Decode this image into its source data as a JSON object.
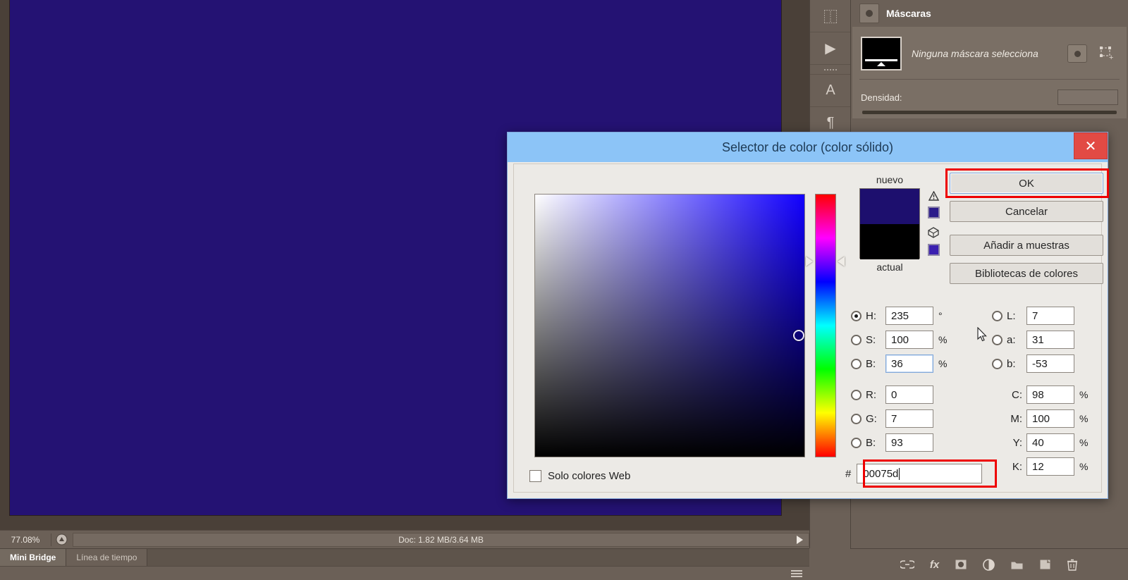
{
  "app": {
    "canvas_color": "#241273",
    "workspace_bg": "#6b6057"
  },
  "statusbar": {
    "zoom": "77.08%",
    "doc_info": "Doc: 1.82 MB/3.64 MB",
    "thumb_icon": "document-thumbnail-icon",
    "play_icon": "play-arrow-icon"
  },
  "taskbar": {
    "tabs": [
      {
        "label": "Mini Bridge",
        "active": true
      },
      {
        "label": "Línea de tiempo",
        "active": false
      }
    ],
    "menu_icon": "hamburger-menu-icon"
  },
  "tool_strip": {
    "items": [
      {
        "icon": "align-icon",
        "glyph": "⿰"
      },
      {
        "icon": "play-triangle-icon",
        "glyph": "▶"
      },
      {
        "icon": "grip-icon",
        "glyph": ""
      },
      {
        "icon": "character-panel-icon",
        "glyph": "A"
      },
      {
        "icon": "paragraph-panel-icon",
        "glyph": "¶"
      }
    ]
  },
  "masks_panel": {
    "title": "Máscaras",
    "header_icon": "mask-panel-icon",
    "mask_status": "Ninguna máscara selecciona",
    "pixel_mask_icon": "pixel-mask-icon",
    "vector_mask_icon": "vector-mask-add-icon",
    "density": {
      "label": "Densidad:",
      "value": ""
    }
  },
  "layer_bottom_bar": {
    "icons": [
      {
        "name": "link-layers-icon",
        "glyph": "🔗"
      },
      {
        "name": "layer-style-fx-icon",
        "glyph": "fx"
      },
      {
        "name": "add-layer-mask-icon",
        "glyph": "▣"
      },
      {
        "name": "adjustment-layer-icon",
        "glyph": "◐"
      },
      {
        "name": "new-group-icon",
        "glyph": "🗀"
      },
      {
        "name": "new-layer-icon",
        "glyph": "❐"
      },
      {
        "name": "delete-layer-icon",
        "glyph": "🗑"
      }
    ]
  },
  "dialog": {
    "title": "Selector de color (color sólido)",
    "close_icon": "close-icon",
    "preview": {
      "new_label": "nuevo",
      "current_label": "actual",
      "new_color": "#1d0f6e",
      "current_color": "#000000"
    },
    "warnings": {
      "gamut_icon": "out-of-gamut-warning-icon",
      "gamut_swatch": "#2b1b8a",
      "websafe_icon": "non-websafe-cube-icon",
      "websafe_swatch": "#3a1fb0"
    },
    "buttons": {
      "ok": "OK",
      "cancel": "Cancelar",
      "add_swatch": "Añadir a muestras",
      "color_libraries": "Bibliotecas de colores",
      "ok_highlighted": true,
      "highlight_color": "#ee0000"
    },
    "hsb": [
      {
        "label": "H:",
        "value": "235",
        "unit": "°",
        "selected": true
      },
      {
        "label": "S:",
        "value": "100",
        "unit": "%",
        "selected": false
      },
      {
        "label": "B:",
        "value": "36",
        "unit": "%",
        "selected": false
      }
    ],
    "rgb": [
      {
        "label": "R:",
        "value": "0",
        "unit": "",
        "selected": false
      },
      {
        "label": "G:",
        "value": "7",
        "unit": "",
        "selected": false
      },
      {
        "label": "B:",
        "value": "93",
        "unit": "",
        "selected": false
      }
    ],
    "lab": [
      {
        "label": "L:",
        "value": "7",
        "unit": "",
        "selected": false
      },
      {
        "label": "a:",
        "value": "31",
        "unit": "",
        "selected": false
      },
      {
        "label": "b:",
        "value": "-53",
        "unit": "",
        "selected": false
      }
    ],
    "cmyk": [
      {
        "label": "C:",
        "value": "98",
        "unit": "%"
      },
      {
        "label": "M:",
        "value": "100",
        "unit": "%"
      },
      {
        "label": "Y:",
        "value": "40",
        "unit": "%"
      },
      {
        "label": "K:",
        "value": "12",
        "unit": "%"
      }
    ],
    "websafe_only": {
      "label": "Solo colores Web",
      "checked": false
    },
    "hex": {
      "prefix": "#",
      "value": "00075d",
      "highlighted": true
    }
  }
}
